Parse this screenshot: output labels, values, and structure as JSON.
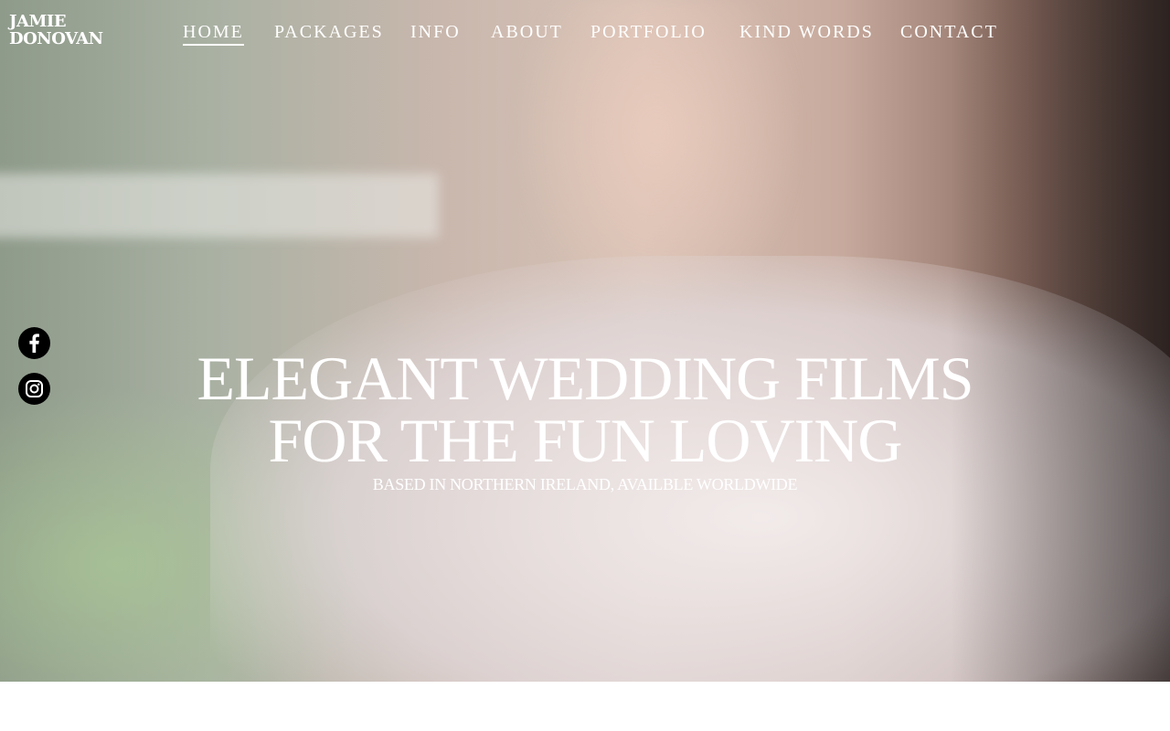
{
  "brand": {
    "line1": "JAMIE",
    "line2": "DONOVAN"
  },
  "nav": {
    "items": [
      {
        "label": "HOME",
        "active": true
      },
      {
        "label": "PACKAGES"
      },
      {
        "label": "INFO"
      },
      {
        "label": "ABOUT"
      },
      {
        "label": "PORTFOLIO"
      },
      {
        "label": "KIND WORDS"
      },
      {
        "label": "CONTACT"
      }
    ]
  },
  "social": [
    {
      "icon": "facebook-icon"
    },
    {
      "icon": "instagram-icon"
    }
  ],
  "hero": {
    "title_line1": "ELEGANT WEDDING FILMS",
    "title_line2": "FOR THE FUN LOVING",
    "subtitle": "BASED IN NORTHERN IRELAND, AVAILBLE WORLDWIDE"
  },
  "colors": {
    "text": "#ffffff",
    "social_bg": "#000000",
    "page_bg": "#ffffff"
  }
}
